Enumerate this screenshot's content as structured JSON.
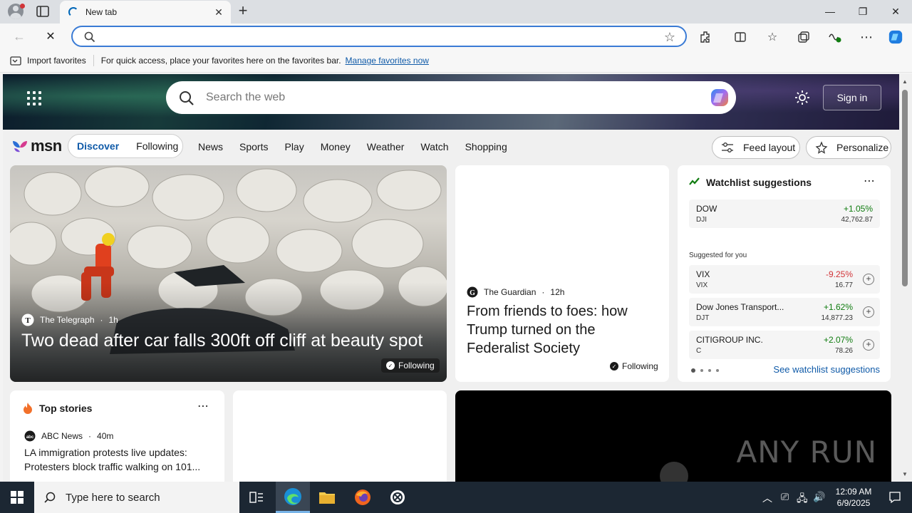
{
  "browser": {
    "tab_title": "New tab",
    "favorites_bar": {
      "import_label": "Import favorites",
      "hint": "For quick access, place your favorites here on the favorites bar.",
      "manage_link": "Manage favorites now"
    }
  },
  "msn": {
    "search_placeholder": "Search the web",
    "signin_label": "Sign in",
    "logo_text": "msn",
    "pill": {
      "discover": "Discover",
      "following": "Following"
    },
    "nav": [
      "News",
      "Sports",
      "Play",
      "Money",
      "Weather",
      "Watch",
      "Shopping"
    ],
    "feed_layout_label": "Feed layout",
    "personalize_label": "Personalize",
    "hero_card": {
      "source": "The Telegraph",
      "age": "1h",
      "headline": "Two dead after car falls 300ft off cliff at beauty spot",
      "following": "Following"
    },
    "guardian_card": {
      "source": "The Guardian",
      "age": "12h",
      "headline": "From friends to foes: how Trump turned on the Federalist Society",
      "following": "Following"
    },
    "watchlist": {
      "title": "Watchlist suggestions",
      "top": {
        "name": "DOW",
        "symbol": "DJI",
        "change": "+1.05%",
        "price": "42,762.87"
      },
      "suggested_label": "Suggested for you",
      "items": [
        {
          "name": "VIX",
          "symbol": "VIX",
          "change": "-9.25%",
          "price": "16.77",
          "color": "#d13438"
        },
        {
          "name": "Dow Jones Transport...",
          "symbol": "DJT",
          "change": "+1.62%",
          "price": "14,877.23",
          "color": "#107c10"
        },
        {
          "name": "CITIGROUP INC.",
          "symbol": "C",
          "change": "+2.07%",
          "price": "78.26",
          "color": "#107c10"
        }
      ],
      "see_more": "See watchlist suggestions"
    },
    "top_stories": {
      "title": "Top stories",
      "source": "ABC News",
      "age": "40m",
      "headline": "LA immigration protests live updates: Protesters block traffic walking on 101..."
    },
    "watermark": "ANY RUN"
  },
  "taskbar": {
    "search_placeholder": "Type here to search",
    "time": "12:09 AM",
    "date": "6/9/2025"
  },
  "colors": {
    "accent": "#0f5aa8",
    "positive": "#107c10",
    "negative": "#d13438"
  }
}
